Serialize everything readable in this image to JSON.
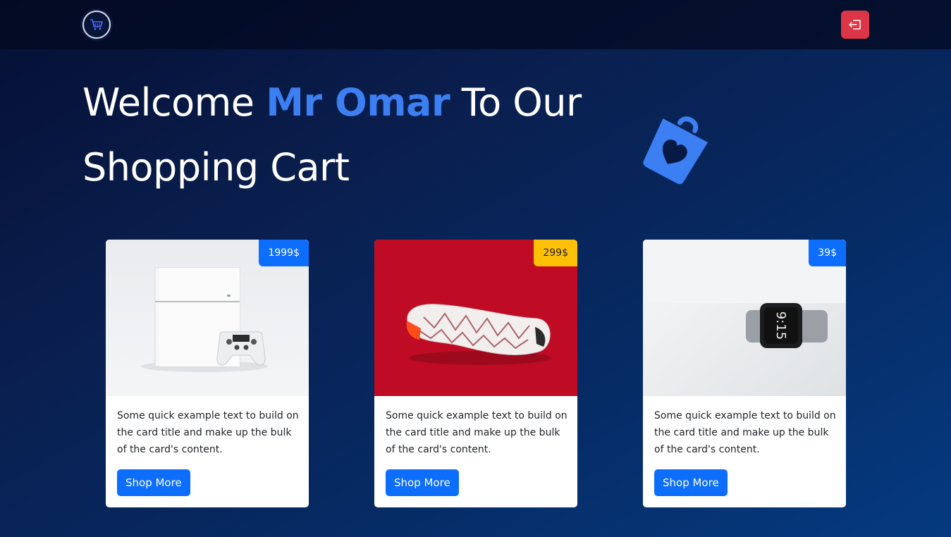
{
  "navbar": {
    "logo_icon": "shopping-cart-icon",
    "logout_icon": "logout-icon",
    "logout_color": "#dc3545"
  },
  "hero": {
    "title_before": "Welcome ",
    "title_name": "Mr Omar",
    "title_after": " To Our Shopping Cart",
    "accent_color": "#3b7ff2",
    "illustration_icon": "shopping-bag-heart-icon"
  },
  "cards": [
    {
      "image": "game-console-photo",
      "price": "1999$",
      "badge_color": "#0d6efd",
      "text": "Some quick example text to build on the card title and make up the bulk of the card's content.",
      "button_label": "Shop More"
    },
    {
      "image": "sneaker-photo",
      "price": "299$",
      "badge_color": "#ffc107",
      "text": "Some quick example text to build on the card title and make up the bulk of the card's content.",
      "button_label": "Shop More"
    },
    {
      "image": "smartwatch-photo",
      "price": "39$",
      "badge_color": "#0d6efd",
      "text": "Some quick example text to build on the card title and make up the bulk of the card's content.",
      "button_label": "Shop More"
    }
  ]
}
